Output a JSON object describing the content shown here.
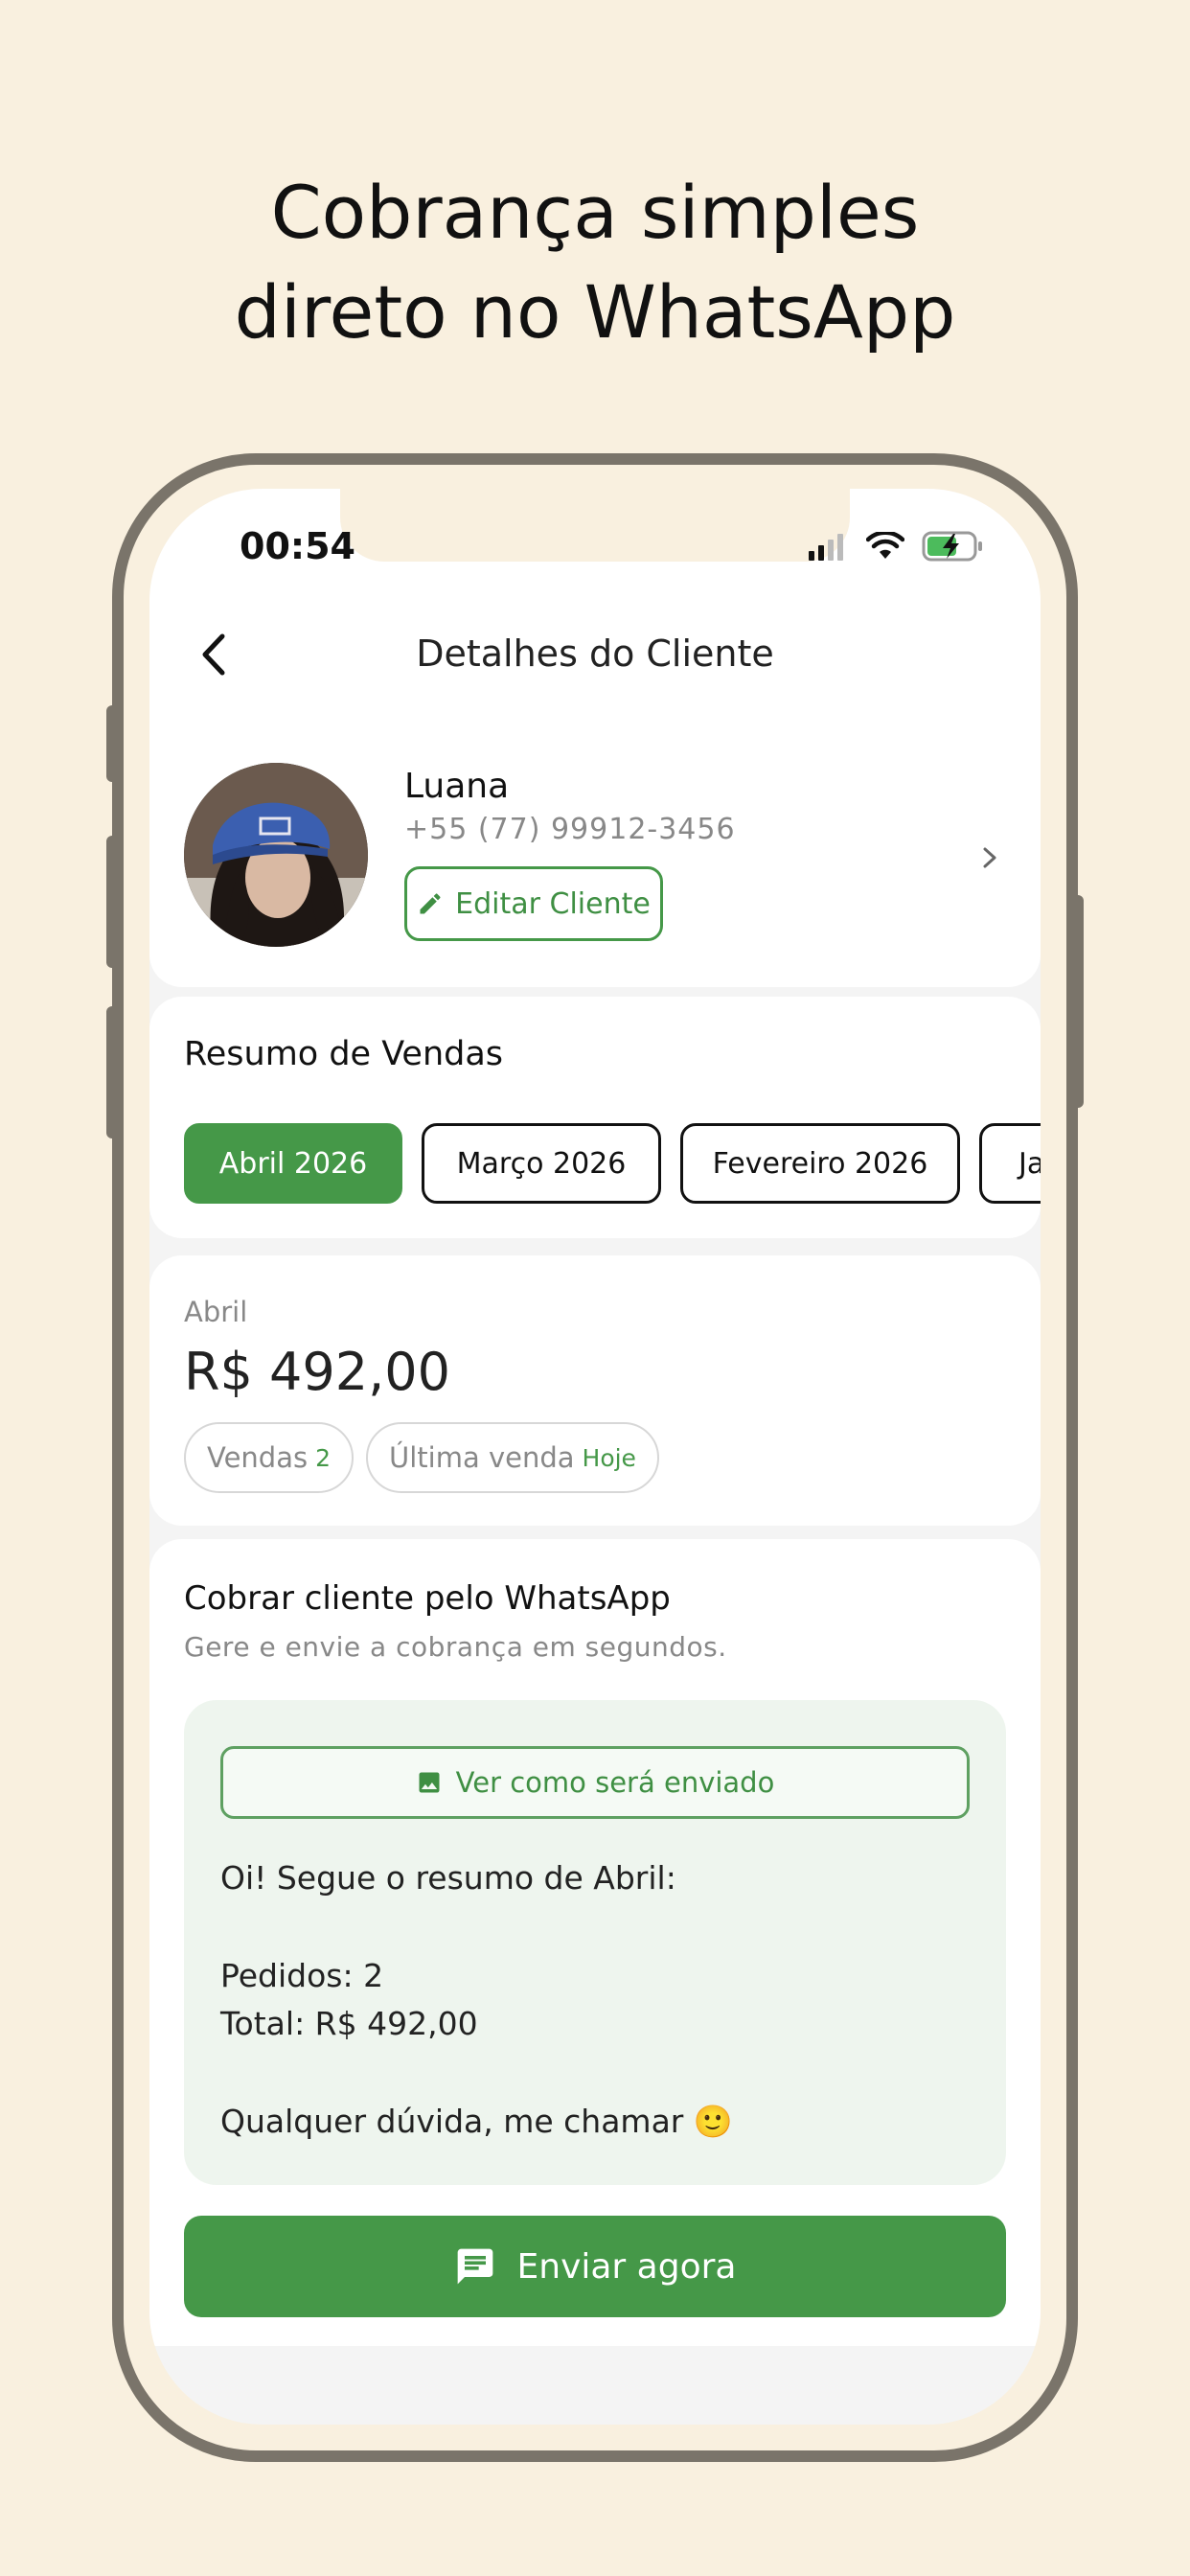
{
  "headline": {
    "line1": "Cobrança simples",
    "line2": "direto no WhatsApp"
  },
  "status_bar": {
    "time": "00:54"
  },
  "header": {
    "title": "Detalhes do Cliente",
    "back_icon": "chevron-left-icon"
  },
  "client": {
    "name": "Luana",
    "phone": "+55 (77) 99912-3456",
    "edit_label": "Editar Cliente",
    "edit_icon": "pencil-icon"
  },
  "sales_summary": {
    "title": "Resumo de Vendas",
    "months": [
      {
        "label": "Abril 2026",
        "selected": true
      },
      {
        "label": "Março 2026",
        "selected": false
      },
      {
        "label": "Fevereiro 2026",
        "selected": false
      },
      {
        "label": "Ja",
        "selected": false
      }
    ]
  },
  "month_summary": {
    "month": "Abril",
    "amount": "R$ 492,00",
    "sales_label": "Vendas",
    "sales_count": "2",
    "last_sale_label": "Última venda",
    "last_sale_value": "Hoje"
  },
  "charge": {
    "title": "Cobrar cliente pelo WhatsApp",
    "subtitle": "Gere e envie a cobrança em segundos.",
    "preview_label": "Ver como será enviado",
    "message_line1": "Oi! Segue o resumo de Abril:",
    "message_line2": "Pedidos: 2",
    "message_line3": "Total: R$ 492,00",
    "message_line4": "Qualquer dúvida, me chamar",
    "message_emoji": "🙂",
    "send_label": "Enviar agora"
  },
  "colors": {
    "accent": "#459848",
    "background": "#f9f0df",
    "frame": "#7a746a"
  }
}
